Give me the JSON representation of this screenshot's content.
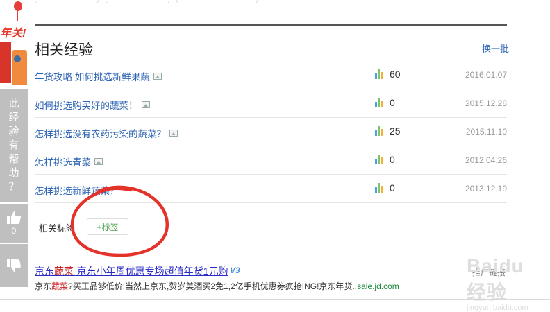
{
  "promo": {
    "text": "年关!"
  },
  "feedback": {
    "helpful_chars": [
      "此",
      "经",
      "验",
      "有",
      "帮",
      "助",
      "？"
    ],
    "upvote_count": "0"
  },
  "related": {
    "title": "相关经验",
    "refresh_label": "换一批",
    "items": [
      {
        "title": "年货攻略 如何挑选新鲜果蔬",
        "count": "60",
        "date": "2016.01.07"
      },
      {
        "title": "如何挑选购买好的蔬菜！",
        "count": "0",
        "date": "2015.12.28"
      },
      {
        "title": "怎样挑选没有农药污染的蔬菜？",
        "count": "25",
        "date": "2015.11.10"
      },
      {
        "title": "怎样挑选青菜",
        "count": "0",
        "date": "2012.04.26"
      },
      {
        "title": "怎样挑选新鲜蔬菜？",
        "count": "0",
        "date": "2013.12.19"
      }
    ]
  },
  "tags": {
    "label": "相关标签",
    "add_label": "+标签"
  },
  "ad": {
    "title_pre": "京东",
    "title_hl": "蔬菜",
    "title_post": "-京东小年周优惠专场超值年货1元购",
    "badge": "V3",
    "desc_pre": "京东",
    "desc_hl": "蔬菜",
    "desc_post": "?买正品够低价!当然上京东,贺岁美酒买2免1,2亿手机优惠券疯抢ING!京东年货..",
    "desc_url": "sale.jd.com",
    "mark": "推广链接"
  },
  "watermark": {
    "main": "Baidu经验",
    "sub": "jingyan.baidu.com"
  },
  "colors": {
    "link": "#2d64b3",
    "annotation": "#e4322b",
    "sidebar": "#bfbfbf"
  }
}
